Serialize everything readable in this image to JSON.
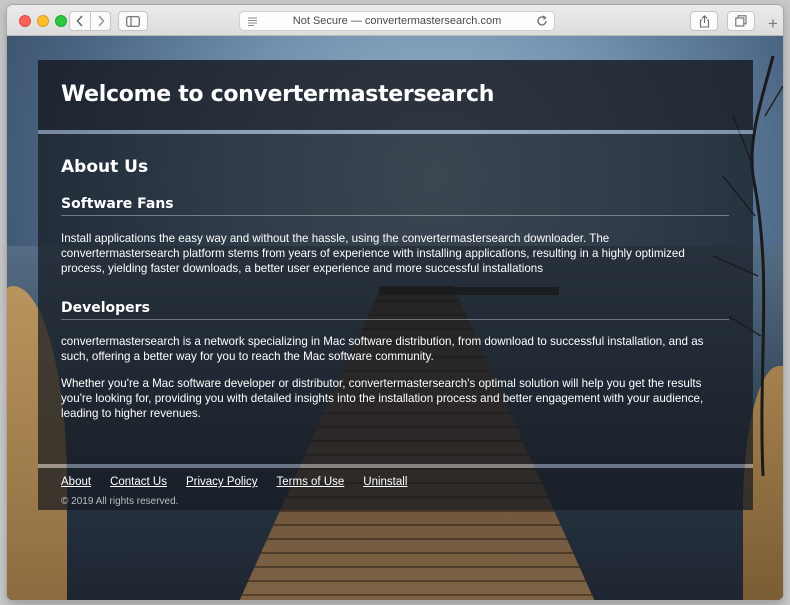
{
  "browser": {
    "address": "Not Secure — convertermastersearch.com",
    "new_tab": "+"
  },
  "page": {
    "title": "Welcome to convertermastersearch",
    "about_heading": "About Us",
    "sections": [
      {
        "heading": "Software Fans",
        "paragraphs": [
          "Install applications the easy way and without the hassle, using the convertermastersearch downloader. The convertermastersearch platform stems from years of experience with installing applications, resulting in a highly optimized process, yielding faster downloads, a better user experience and more successful installations"
        ]
      },
      {
        "heading": "Developers",
        "paragraphs": [
          "convertermastersearch is a network specializing in Mac software distribution, from download to successful installation, and as such, offering a better way for you to reach the Mac software community.",
          "Whether you're a Mac software developer or distributor, convertermastersearch's optimal solution will help you get the results you're looking for, providing you with detailed insights into the installation process and better engagement with your audience, leading to higher revenues."
        ]
      }
    ]
  },
  "footer": {
    "links": [
      "About",
      "Contact Us",
      "Privacy Policy",
      "Terms of Use",
      "Uninstall"
    ],
    "copyright": "© 2019 All rights reserved."
  },
  "colors": {
    "panel_bg": "#161a21",
    "text": "#ffffff"
  }
}
